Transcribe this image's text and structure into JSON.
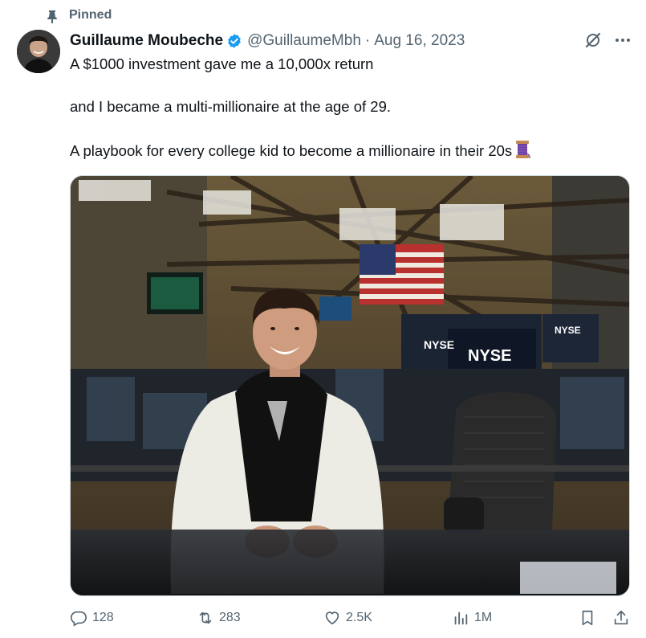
{
  "pinned_label": "Pinned",
  "author": {
    "name": "Guillaume Moubeche",
    "handle": "@GuillaumeMbh",
    "verified": true,
    "separator": "·",
    "date": "Aug 16, 2023"
  },
  "tweet": {
    "line1": "A $1000 investment gave me a 10,000x return",
    "line2": "and I became a multi-millionaire at the age of 29.",
    "line3": "A  playbook for every college kid to become a millionaire in their 20s",
    "emoji": "spool-of-thread"
  },
  "media": {
    "sign_text_1": "NYSE",
    "sign_text_2": "NYSE",
    "sign_text_3": "NYSE",
    "description_icon": "photo-nyse-trading-floor"
  },
  "stats": {
    "replies": "128",
    "reposts": "283",
    "likes": "2.5K",
    "views": "1M"
  },
  "colors": {
    "text": "#0f1419",
    "muted": "#536471",
    "verified_blue": "#1d9bf0"
  }
}
